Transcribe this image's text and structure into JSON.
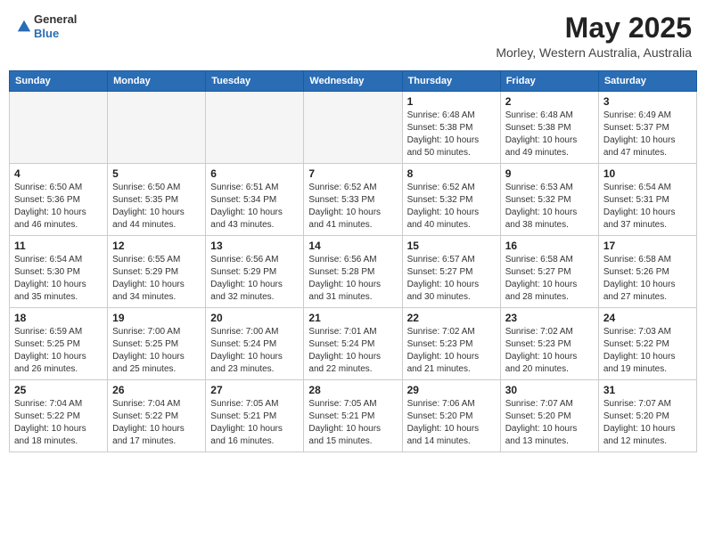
{
  "header": {
    "logo": {
      "line1": "General",
      "line2": "Blue"
    },
    "title": "May 2025",
    "location": "Morley, Western Australia, Australia"
  },
  "weekdays": [
    "Sunday",
    "Monday",
    "Tuesday",
    "Wednesday",
    "Thursday",
    "Friday",
    "Saturday"
  ],
  "weeks": [
    [
      {
        "day": "",
        "info": ""
      },
      {
        "day": "",
        "info": ""
      },
      {
        "day": "",
        "info": ""
      },
      {
        "day": "",
        "info": ""
      },
      {
        "day": "1",
        "info": "Sunrise: 6:48 AM\nSunset: 5:38 PM\nDaylight: 10 hours\nand 50 minutes."
      },
      {
        "day": "2",
        "info": "Sunrise: 6:48 AM\nSunset: 5:38 PM\nDaylight: 10 hours\nand 49 minutes."
      },
      {
        "day": "3",
        "info": "Sunrise: 6:49 AM\nSunset: 5:37 PM\nDaylight: 10 hours\nand 47 minutes."
      }
    ],
    [
      {
        "day": "4",
        "info": "Sunrise: 6:50 AM\nSunset: 5:36 PM\nDaylight: 10 hours\nand 46 minutes."
      },
      {
        "day": "5",
        "info": "Sunrise: 6:50 AM\nSunset: 5:35 PM\nDaylight: 10 hours\nand 44 minutes."
      },
      {
        "day": "6",
        "info": "Sunrise: 6:51 AM\nSunset: 5:34 PM\nDaylight: 10 hours\nand 43 minutes."
      },
      {
        "day": "7",
        "info": "Sunrise: 6:52 AM\nSunset: 5:33 PM\nDaylight: 10 hours\nand 41 minutes."
      },
      {
        "day": "8",
        "info": "Sunrise: 6:52 AM\nSunset: 5:32 PM\nDaylight: 10 hours\nand 40 minutes."
      },
      {
        "day": "9",
        "info": "Sunrise: 6:53 AM\nSunset: 5:32 PM\nDaylight: 10 hours\nand 38 minutes."
      },
      {
        "day": "10",
        "info": "Sunrise: 6:54 AM\nSunset: 5:31 PM\nDaylight: 10 hours\nand 37 minutes."
      }
    ],
    [
      {
        "day": "11",
        "info": "Sunrise: 6:54 AM\nSunset: 5:30 PM\nDaylight: 10 hours\nand 35 minutes."
      },
      {
        "day": "12",
        "info": "Sunrise: 6:55 AM\nSunset: 5:29 PM\nDaylight: 10 hours\nand 34 minutes."
      },
      {
        "day": "13",
        "info": "Sunrise: 6:56 AM\nSunset: 5:29 PM\nDaylight: 10 hours\nand 32 minutes."
      },
      {
        "day": "14",
        "info": "Sunrise: 6:56 AM\nSunset: 5:28 PM\nDaylight: 10 hours\nand 31 minutes."
      },
      {
        "day": "15",
        "info": "Sunrise: 6:57 AM\nSunset: 5:27 PM\nDaylight: 10 hours\nand 30 minutes."
      },
      {
        "day": "16",
        "info": "Sunrise: 6:58 AM\nSunset: 5:27 PM\nDaylight: 10 hours\nand 28 minutes."
      },
      {
        "day": "17",
        "info": "Sunrise: 6:58 AM\nSunset: 5:26 PM\nDaylight: 10 hours\nand 27 minutes."
      }
    ],
    [
      {
        "day": "18",
        "info": "Sunrise: 6:59 AM\nSunset: 5:25 PM\nDaylight: 10 hours\nand 26 minutes."
      },
      {
        "day": "19",
        "info": "Sunrise: 7:00 AM\nSunset: 5:25 PM\nDaylight: 10 hours\nand 25 minutes."
      },
      {
        "day": "20",
        "info": "Sunrise: 7:00 AM\nSunset: 5:24 PM\nDaylight: 10 hours\nand 23 minutes."
      },
      {
        "day": "21",
        "info": "Sunrise: 7:01 AM\nSunset: 5:24 PM\nDaylight: 10 hours\nand 22 minutes."
      },
      {
        "day": "22",
        "info": "Sunrise: 7:02 AM\nSunset: 5:23 PM\nDaylight: 10 hours\nand 21 minutes."
      },
      {
        "day": "23",
        "info": "Sunrise: 7:02 AM\nSunset: 5:23 PM\nDaylight: 10 hours\nand 20 minutes."
      },
      {
        "day": "24",
        "info": "Sunrise: 7:03 AM\nSunset: 5:22 PM\nDaylight: 10 hours\nand 19 minutes."
      }
    ],
    [
      {
        "day": "25",
        "info": "Sunrise: 7:04 AM\nSunset: 5:22 PM\nDaylight: 10 hours\nand 18 minutes."
      },
      {
        "day": "26",
        "info": "Sunrise: 7:04 AM\nSunset: 5:22 PM\nDaylight: 10 hours\nand 17 minutes."
      },
      {
        "day": "27",
        "info": "Sunrise: 7:05 AM\nSunset: 5:21 PM\nDaylight: 10 hours\nand 16 minutes."
      },
      {
        "day": "28",
        "info": "Sunrise: 7:05 AM\nSunset: 5:21 PM\nDaylight: 10 hours\nand 15 minutes."
      },
      {
        "day": "29",
        "info": "Sunrise: 7:06 AM\nSunset: 5:20 PM\nDaylight: 10 hours\nand 14 minutes."
      },
      {
        "day": "30",
        "info": "Sunrise: 7:07 AM\nSunset: 5:20 PM\nDaylight: 10 hours\nand 13 minutes."
      },
      {
        "day": "31",
        "info": "Sunrise: 7:07 AM\nSunset: 5:20 PM\nDaylight: 10 hours\nand 12 minutes."
      }
    ]
  ]
}
